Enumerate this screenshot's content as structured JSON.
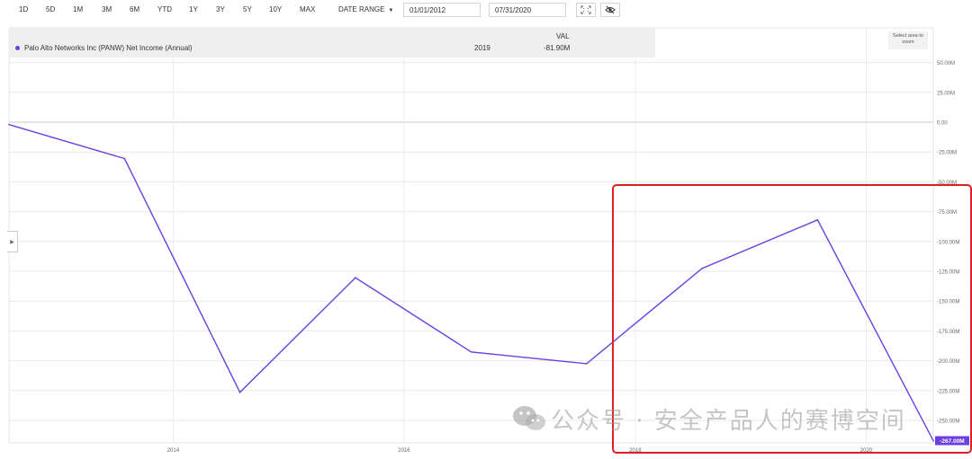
{
  "toolbar": {
    "ranges": [
      "1D",
      "5D",
      "1M",
      "3M",
      "6M",
      "YTD",
      "1Y",
      "3Y",
      "5Y",
      "10Y",
      "MAX"
    ],
    "date_range_label": "DATE RANGE",
    "start_date": "01/01/2012",
    "end_date": "07/31/2020",
    "icons": [
      "expand-icon",
      "eye-slash-icon"
    ]
  },
  "legend": {
    "val_header": "VAL",
    "series_name": "Palo Alto Networks Inc (PANW) Net Income (Annual)",
    "year": "2019",
    "value": "-81.90M",
    "dot_color": "#6b3fe0"
  },
  "zoom_hint": "Select area to zoom",
  "watermark": "公众号 · 安全产品人的赛博空间",
  "highlight_color": "#e02020",
  "chart_data": {
    "type": "line",
    "series": [
      {
        "name": "Palo Alto Networks Inc (PANW) Net Income (Annual)",
        "color": "#6b3fe0",
        "x": [
          "2012-07-31",
          "2013-07-31",
          "2014-07-31",
          "2015-07-31",
          "2016-07-31",
          "2017-07-31",
          "2018-07-31",
          "2019-07-31",
          "2020-07-31"
        ],
        "y": [
          -2,
          -30.5,
          -226.5,
          -130.4,
          -192.6,
          -202.5,
          -122.6,
          -81.9,
          -267
        ]
      }
    ],
    "x_range": [
      "2012-07-31",
      "2020-07-31"
    ],
    "x_ticks": [
      {
        "label": "2014",
        "date": "2014-01-01"
      },
      {
        "label": "2016",
        "date": "2016-01-01"
      },
      {
        "label": "2018",
        "date": "2018-01-01"
      },
      {
        "label": "2020",
        "date": "2020-01-01"
      }
    ],
    "ylim": [
      -267,
      50
    ],
    "y_ticks": [
      50,
      25,
      0,
      -25,
      -50,
      -75,
      -100,
      -125,
      -150,
      -175,
      -200,
      -225,
      -250
    ],
    "y_tick_labels": [
      "50.00M",
      "25.00M",
      "0.00",
      "-25.00M",
      "-50.00M",
      "-75.00M",
      "-100.00M",
      "-125.00M",
      "-150.00M",
      "-175.00M",
      "-200.00M",
      "-225.00M",
      "-250.00M"
    ],
    "last_value_label": "-267.00M",
    "grid": true,
    "y_axis_position": "right"
  }
}
